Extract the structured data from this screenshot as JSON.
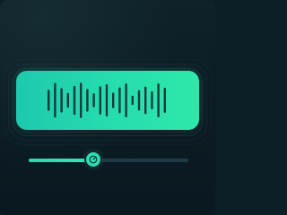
{
  "player": {
    "waveform": {
      "bar_heights": [
        0.54,
        0.88,
        0.62,
        0.38,
        0.74,
        0.9,
        0.58,
        0.36,
        0.72,
        0.82,
        0.4,
        0.66,
        0.86,
        0.24,
        0.52,
        0.7,
        0.46,
        0.86,
        0.64
      ],
      "bar_color": "#123a3a",
      "panel_color_start": "#1ec9ad",
      "panel_color_end": "#2ee8a9"
    },
    "seek_slider": {
      "progress": 0.41,
      "thumb_icon": "gauge-icon",
      "accent_color": "#2fdcb0",
      "track_color": "#1f3a44"
    }
  }
}
